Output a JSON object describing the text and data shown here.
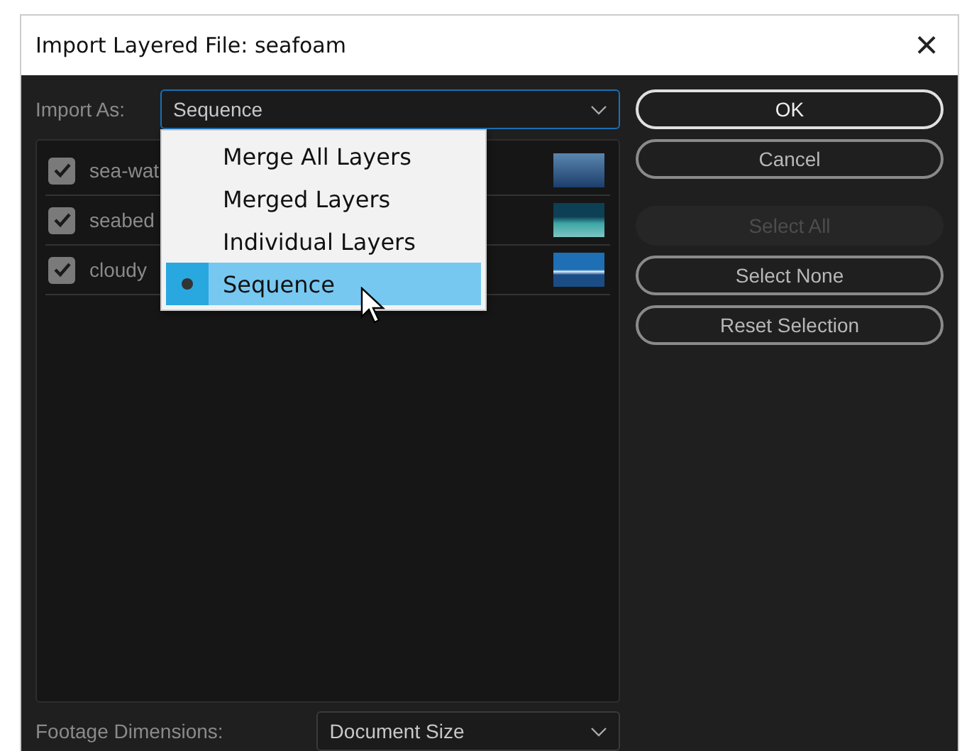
{
  "window": {
    "title": "Import Layered File: seafoam",
    "close": "×"
  },
  "import_as": {
    "label": "Import As:",
    "value": "Sequence",
    "expanded": true,
    "options": [
      {
        "label": "Merge All Layers",
        "selected": false
      },
      {
        "label": "Merged Layers",
        "selected": false
      },
      {
        "label": "Individual Layers",
        "selected": false
      },
      {
        "label": "Sequence",
        "selected": true
      }
    ]
  },
  "layers": [
    {
      "name": "sea-wat",
      "checked": true
    },
    {
      "name": "seabed",
      "checked": true
    },
    {
      "name": "cloudy",
      "checked": true
    }
  ],
  "buttons": [
    {
      "label": "OK",
      "disabled": false,
      "default": true
    },
    {
      "label": "Cancel",
      "disabled": false,
      "default": false
    },
    {
      "label": "Select All",
      "disabled": true,
      "default": false
    },
    {
      "label": "Select None",
      "disabled": false,
      "default": false
    },
    {
      "label": "Reset Selection",
      "disabled": false,
      "default": false
    }
  ],
  "footage": {
    "label": "Footage Dimensions:",
    "value": "Document Size"
  }
}
